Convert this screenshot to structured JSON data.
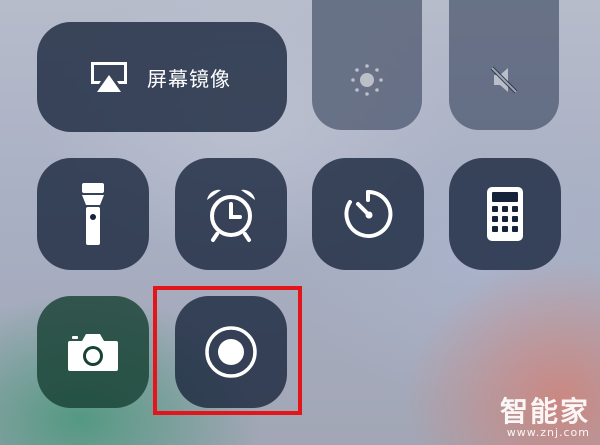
{
  "control_center": {
    "screen_mirroring": {
      "label": "屏幕镜像",
      "icon": "airplay-icon"
    },
    "brightness": {
      "icon": "sun-icon"
    },
    "volume": {
      "icon": "speaker-muted-icon"
    },
    "flashlight": {
      "icon": "flashlight-icon"
    },
    "alarm": {
      "icon": "alarm-clock-icon"
    },
    "timer": {
      "icon": "timer-icon"
    },
    "calculator": {
      "icon": "calculator-icon"
    },
    "camera": {
      "icon": "camera-icon"
    },
    "screen_recording": {
      "icon": "record-icon",
      "highlighted": true
    }
  },
  "colors": {
    "tile": "#16223a",
    "camera_tile": "#184234",
    "highlight_border": "#e3151a"
  },
  "watermark": {
    "title": "智能家",
    "url": "www.znj.com"
  }
}
